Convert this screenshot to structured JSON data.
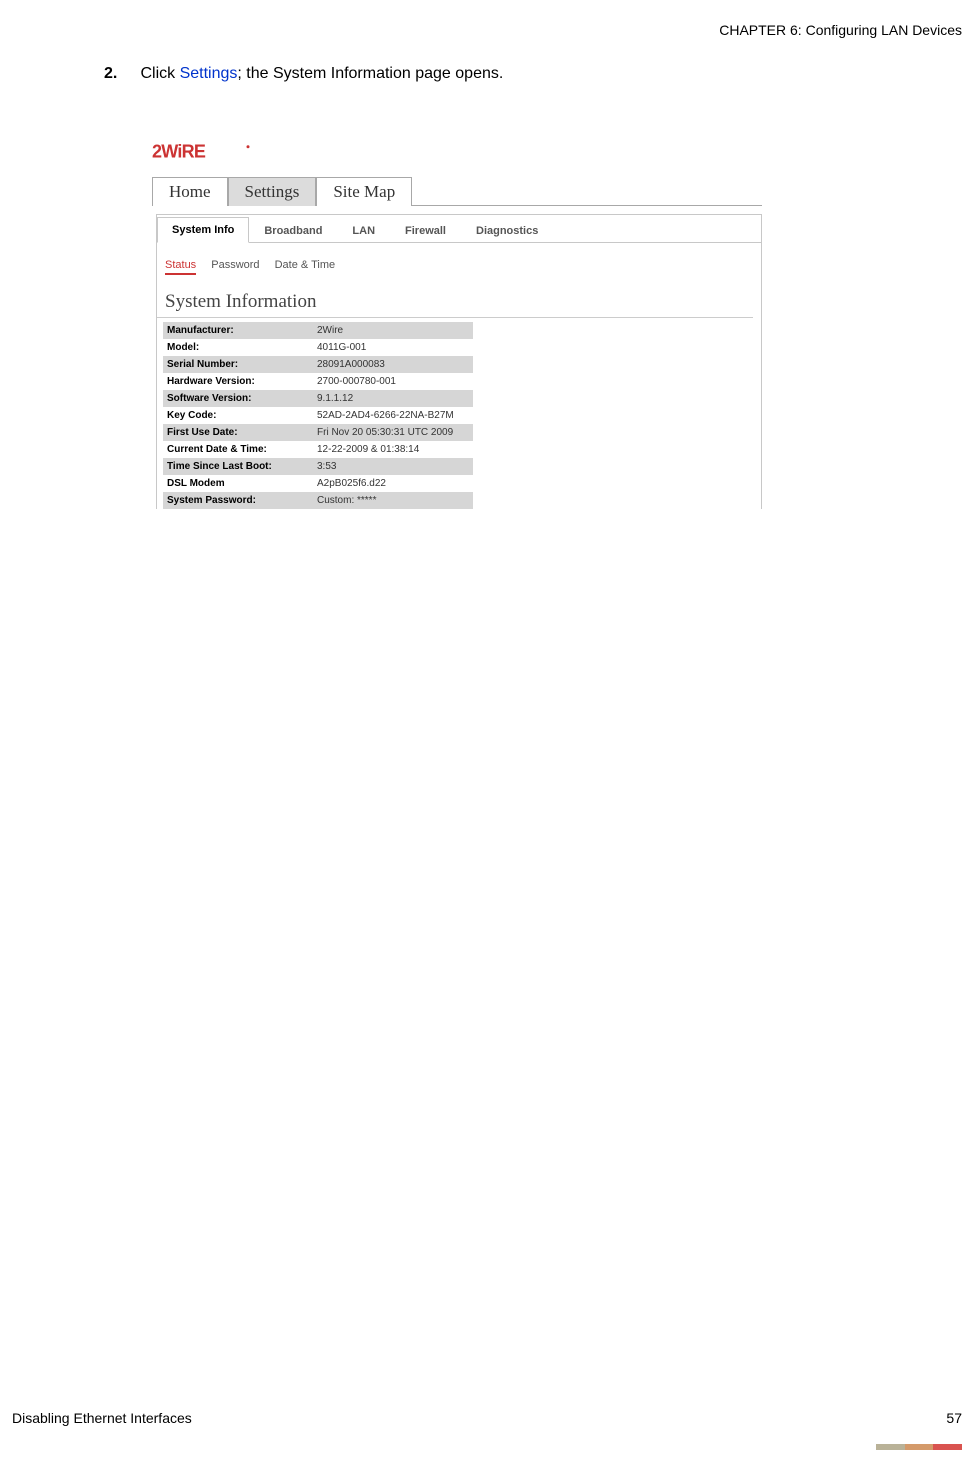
{
  "chapter_header": "CHAPTER 6: Configuring LAN Devices",
  "step": {
    "num": "2.",
    "pre": "Click ",
    "link": "Settings",
    "post": "; the System Information page opens."
  },
  "logo_brand": "2WIRE",
  "primary_tabs": [
    "Home",
    "Settings",
    "Site Map"
  ],
  "primary_active_index": 1,
  "secondary_tabs": [
    "System Info",
    "Broadband",
    "LAN",
    "Firewall",
    "Diagnostics"
  ],
  "secondary_active_index": 0,
  "subnav": [
    "Status",
    "Password",
    "Date & Time"
  ],
  "subnav_active_index": 0,
  "section_title": "System Information",
  "rows": [
    {
      "label": "Manufacturer:",
      "value": "2Wire"
    },
    {
      "label": "Model:",
      "value": "4011G-001"
    },
    {
      "label": "Serial Number:",
      "value": "28091A000083"
    },
    {
      "label": "Hardware Version:",
      "value": "2700-000780-001"
    },
    {
      "label": "Software Version:",
      "value": "9.1.1.12"
    },
    {
      "label": "Key Code:",
      "value": "52AD-2AD4-6266-22NA-B27M"
    },
    {
      "label": "First Use Date:",
      "value": "Fri Nov 20 05:30:31 UTC 2009"
    },
    {
      "label": "Current Date & Time:",
      "value": "12-22-2009 & 01:38:14"
    },
    {
      "label": "Time Since Last Boot:",
      "value": "3:53"
    },
    {
      "label": "DSL Modem",
      "value": "A2pB025f6.d22"
    },
    {
      "label": "System Password:",
      "value": "Custom: *****"
    }
  ],
  "footer_left": "Disabling Ethernet Interfaces",
  "footer_right": "57"
}
